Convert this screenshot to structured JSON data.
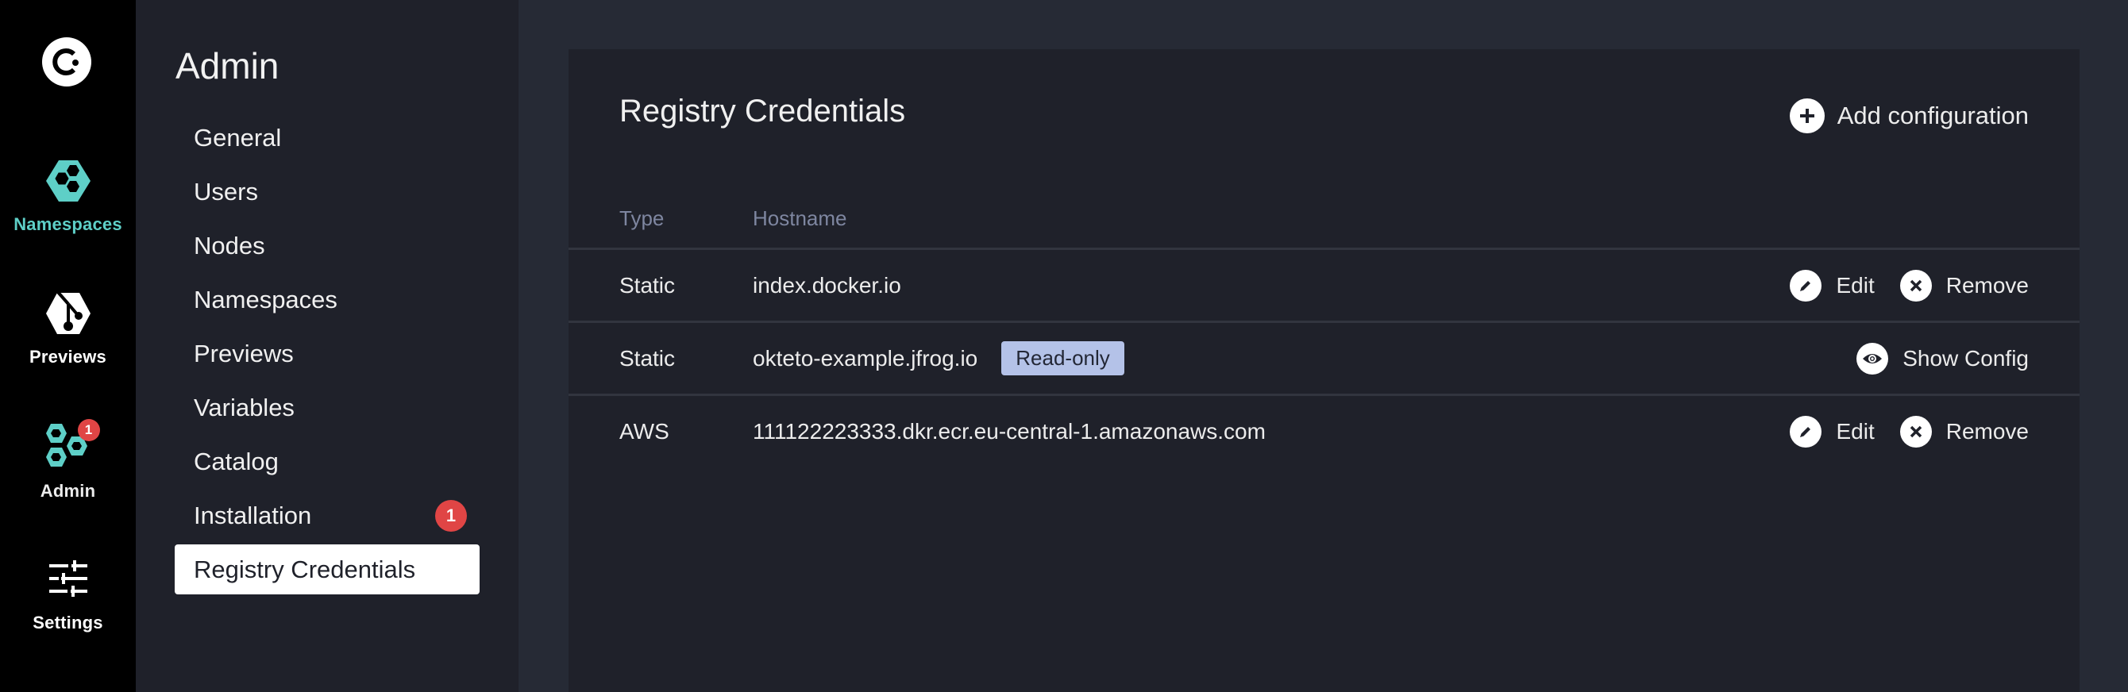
{
  "rail": {
    "logo": "okteto-logo-icon",
    "items": [
      {
        "label": "Namespaces",
        "icon": "namespaces-hexagon-icon",
        "active": true
      },
      {
        "label": "Previews",
        "icon": "git-branch-hexagon-icon",
        "active": false
      },
      {
        "label": "Admin",
        "icon": "admin-hexagons-icon",
        "active": true,
        "badge": "1"
      },
      {
        "label": "Settings",
        "icon": "sliders-icon",
        "active": false
      }
    ]
  },
  "subnav": {
    "title": "Admin",
    "items": [
      {
        "label": "General"
      },
      {
        "label": "Users"
      },
      {
        "label": "Nodes"
      },
      {
        "label": "Namespaces"
      },
      {
        "label": "Previews"
      },
      {
        "label": "Variables"
      },
      {
        "label": "Catalog"
      },
      {
        "label": "Installation",
        "badge": "1"
      },
      {
        "label": "Registry Credentials",
        "active": true
      }
    ]
  },
  "main": {
    "title": "Registry Credentials",
    "add_button": {
      "label": "Add configuration",
      "icon": "plus-circle-icon"
    },
    "table": {
      "columns": [
        "Type",
        "Hostname"
      ],
      "rows": [
        {
          "type": "Static",
          "hostname": "index.docker.io",
          "badge": null,
          "actions": [
            {
              "label": "Edit",
              "icon": "pencil-icon"
            },
            {
              "label": "Remove",
              "icon": "x-circle-icon"
            }
          ]
        },
        {
          "type": "Static",
          "hostname": "okteto-example.jfrog.io",
          "badge": "Read-only",
          "actions": [
            {
              "label": "Show Config",
              "icon": "eye-icon"
            }
          ]
        },
        {
          "type": "AWS",
          "hostname": "111122223333.dkr.ecr.eu-central-1.amazonaws.com",
          "badge": null,
          "actions": [
            {
              "label": "Edit",
              "icon": "pencil-icon"
            },
            {
              "label": "Remove",
              "icon": "x-circle-icon"
            }
          ]
        }
      ]
    }
  },
  "colors": {
    "accent_teal": "#5ecfc7",
    "badge_red": "#e04545",
    "readonly_badge": "#b4c2e8",
    "rail_bg": "#000000",
    "panel_bg": "#1f212a",
    "page_bg": "#262a35"
  }
}
